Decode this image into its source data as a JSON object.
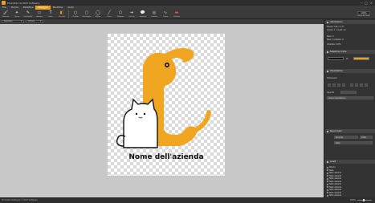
{
  "app": {
    "title": "PhotoPad da NCH Software"
  },
  "menu": [
    "File",
    "Home",
    "Modifica",
    "Disegno",
    "Modifica",
    "Aiuto"
  ],
  "menu_active_index": 3,
  "ribbon": {
    "tools": [
      {
        "label": "Pennello",
        "icon": "brush-icon"
      },
      {
        "label": "Spray",
        "icon": "spray-icon"
      },
      {
        "label": "Pennarello",
        "icon": "marker-icon"
      },
      {
        "label": "Gomma",
        "icon": "eraser-icon"
      },
      {
        "label": "Testo",
        "icon": "text-icon"
      },
      {
        "label": "Secchio",
        "icon": "bucket-icon"
      },
      {
        "label": "Cerchio",
        "icon": "circle-icon"
      },
      {
        "label": "Rettangolo",
        "icon": "rectangle-icon"
      },
      {
        "label": "Ellisse",
        "icon": "ellipse-icon"
      },
      {
        "label": "Linea",
        "icon": "line-icon"
      },
      {
        "label": "Poligono",
        "icon": "polygon-icon"
      },
      {
        "label": "Freccia",
        "icon": "arrow-icon"
      },
      {
        "label": "Fumetto",
        "icon": "speech-bubble-icon"
      },
      {
        "label": "Cerchio",
        "icon": "circle2-icon"
      },
      {
        "label": "Curva",
        "icon": "curve-icon"
      },
      {
        "label": "Gomma",
        "icon": "rubber-icon"
      }
    ],
    "zoom": {
      "value": "100%",
      "label": "Zoom dell'area"
    }
  },
  "strip": {
    "select1": "Pennello",
    "select2": "Colore"
  },
  "canvas": {
    "company_name": "Nome dell'azienda"
  },
  "panel": {
    "info_header": "Informazioni",
    "info_rows": [
      "Misure: 146 × 177",
      "Livello: 1 / Livelli: 12",
      "Base: 0",
      "Base: 0   Altezza: 0",
      "Visibilità: 100%"
    ],
    "colors_header": "Selezione colore",
    "colors": {
      "primary": "#111111",
      "secondary": "#e8a020"
    },
    "props_header": "Impostazioni",
    "props_rows": [
      "Dimensioni",
      "Opacità",
      "Durezza"
    ],
    "props_button": "Usa le impostazioni",
    "layers_header": "Nuovi livelli",
    "layers_blend": "Normale",
    "layers_opacity": "100%",
    "layer_items": [
      "Sfondo",
      "Testo",
      "Testo azienda",
      "Testo azienda",
      "Testo azienda",
      "Testo azienda",
      "Testo azienda",
      "Testo azienda",
      "Testo azienda",
      "Testo azienda",
      "Testo azienda"
    ],
    "layers2_header": "Livelli",
    "layer_selected": "Testo"
  },
  "status": {
    "text": "PhotoPad Software © NCH Software",
    "zoom": "100%",
    "zoom_fraction": 0.45
  }
}
